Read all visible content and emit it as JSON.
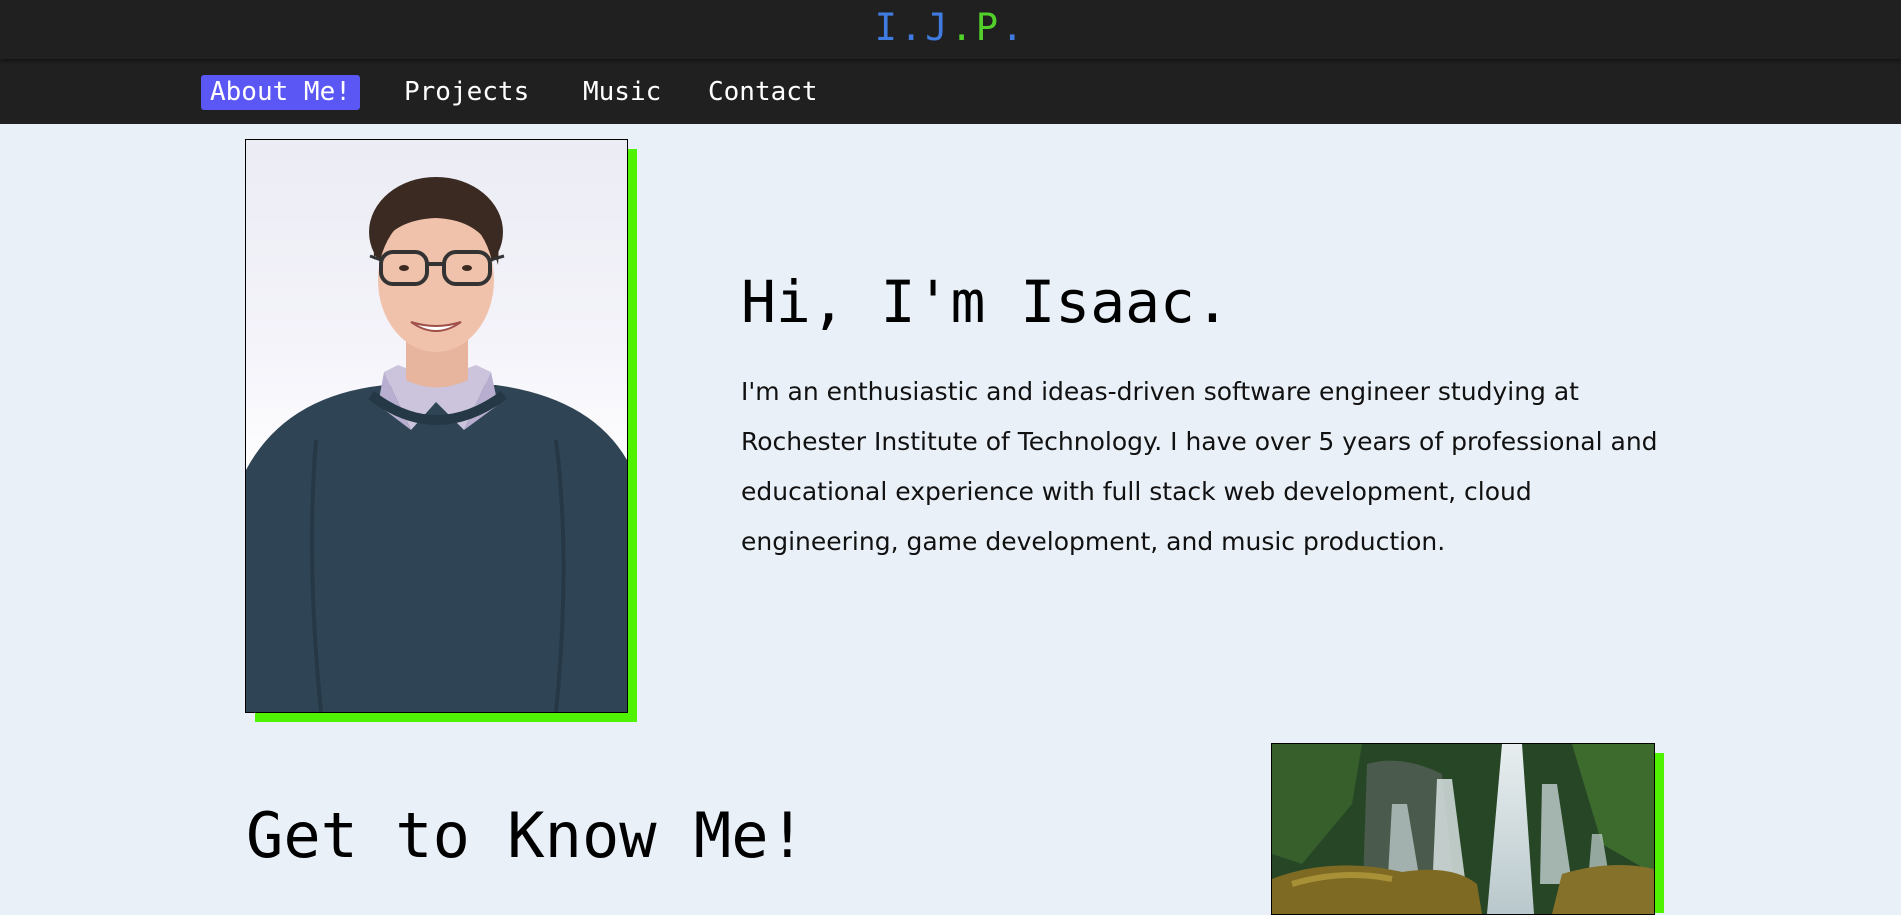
{
  "header": {
    "logo_parts": [
      "I",
      ".",
      "J",
      ".",
      "P",
      "."
    ]
  },
  "nav": {
    "items": [
      {
        "label": "About Me!",
        "active": true
      },
      {
        "label": "Projects",
        "active": false
      },
      {
        "label": "Music",
        "active": false
      },
      {
        "label": "Contact",
        "active": false
      }
    ]
  },
  "hero": {
    "title": "Hi, I'm Isaac.",
    "text": "I'm an enthusiastic and ideas-driven software engineer studying at Rochester Institute of Technology. I have over 5 years of professional and educational experience with full stack web development, cloud engineering, game development, and music production."
  },
  "about": {
    "title": "Get to Know Me!"
  },
  "colors": {
    "page_bg": "#e9f0f7",
    "bar_bg": "#202020",
    "nav_active_bg": "#5b57f5",
    "logo_blue": "#3f7be0",
    "logo_green": "#52d02a",
    "photo_shadow": "#4ff200"
  }
}
